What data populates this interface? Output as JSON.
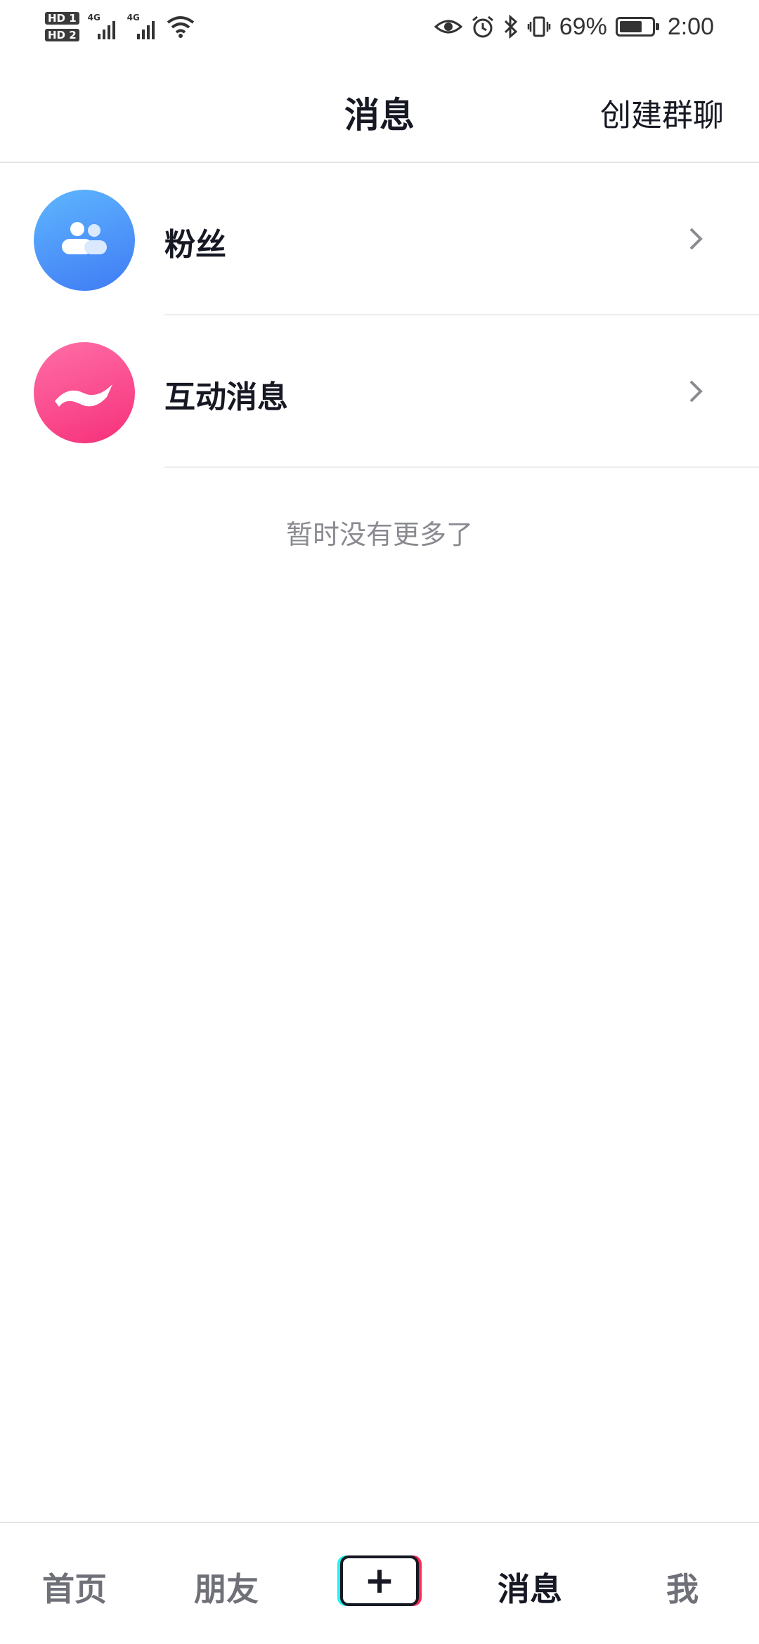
{
  "status_bar": {
    "sim1": "HD 1",
    "sim2": "HD 2",
    "network1": "4G",
    "network2": "4G",
    "battery_percent": "69%",
    "battery_level": 0.69,
    "time": "2:00",
    "icons": [
      "eye-icon",
      "alarm-icon",
      "bluetooth-icon",
      "vibrate-icon",
      "battery-icon",
      "wifi-icon"
    ]
  },
  "header": {
    "title": "消息",
    "create_group": "创建群聊"
  },
  "list": {
    "items": [
      {
        "label": "粉丝",
        "icon": "fans-icon",
        "color": "#4a90f5"
      },
      {
        "label": "互动消息",
        "icon": "interaction-icon",
        "color": "#fa3d85"
      }
    ],
    "empty_text": "暂时没有更多了"
  },
  "bottom_nav": {
    "home": "首页",
    "friends": "朋友",
    "add": "+",
    "messages": "消息",
    "me": "我",
    "active": "messages"
  },
  "colors": {
    "text_primary": "#161823",
    "text_secondary": "#8a8b91",
    "accent_cyan": "#25f4ee",
    "accent_red": "#fe2c55"
  }
}
